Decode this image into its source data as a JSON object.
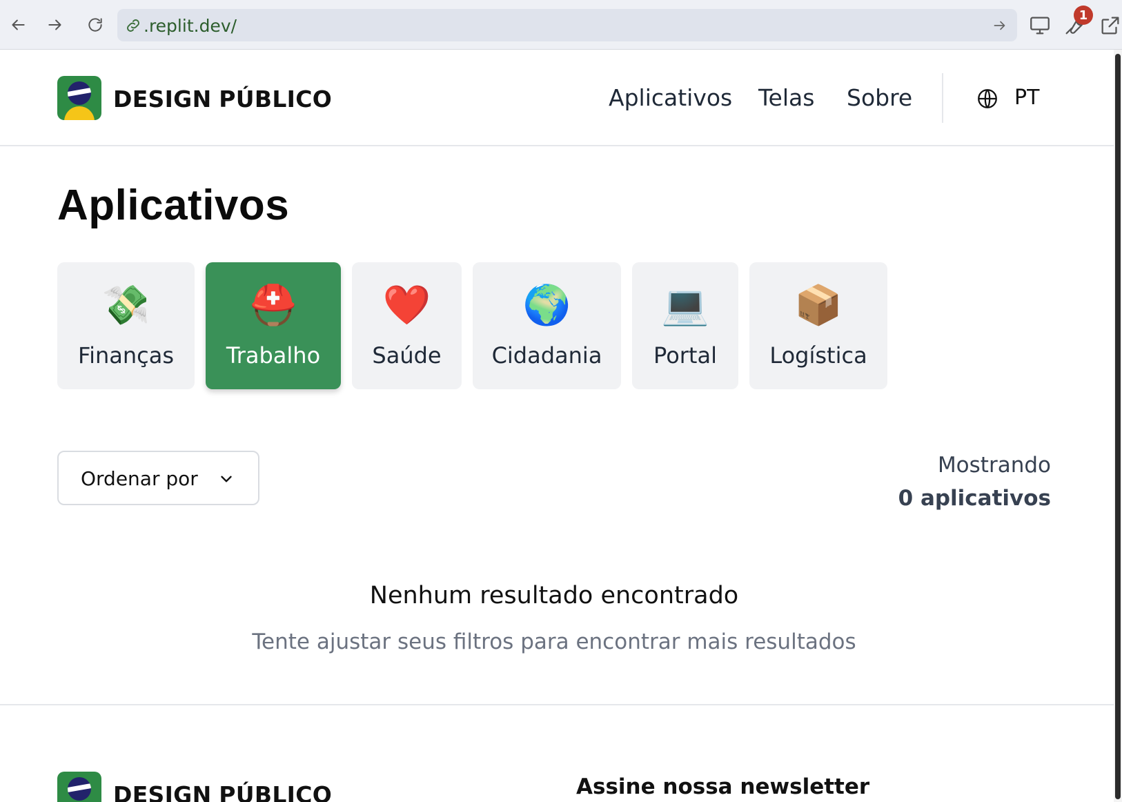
{
  "browser": {
    "url": ".replit.dev/",
    "badge_count": "1",
    "icons": [
      "back-arrow-icon",
      "forward-arrow-icon",
      "reload-icon",
      "link-icon",
      "go-arrow-icon",
      "monitor-icon",
      "wrench-icon",
      "external-link-icon"
    ]
  },
  "header": {
    "brand_bold": "DESIGN",
    "brand_rest": "PÚBLICO",
    "nav": [
      {
        "label": "Aplicativos"
      },
      {
        "label": "Telas"
      },
      {
        "label": "Sobre"
      }
    ],
    "language": "PT"
  },
  "main": {
    "title": "Aplicativos",
    "categories": [
      {
        "emoji": "💸",
        "label": "Finanças",
        "active": false
      },
      {
        "emoji": "⛑️",
        "label": "Trabalho",
        "active": true
      },
      {
        "emoji": "❤️",
        "label": "Saúde",
        "active": false
      },
      {
        "emoji": "🌍",
        "label": "Cidadania",
        "active": false
      },
      {
        "emoji": "💻",
        "label": "Portal",
        "active": false
      },
      {
        "emoji": "📦",
        "label": "Logística",
        "active": false
      }
    ],
    "sort_label": "Ordenar por",
    "results_line1": "Mostrando",
    "results_line2": "0 aplicativos",
    "empty_title": "Nenhum resultado encontrado",
    "empty_subtitle": "Tente ajustar seus filtros para encontrar mais resultados"
  },
  "footer": {
    "brand_bold": "DESIGN",
    "brand_rest": "PÚBLICO",
    "newsletter_title": "Assine nossa newsletter"
  },
  "colors": {
    "accent_green": "#3a9158",
    "logo_green": "#2e8b45",
    "logo_yellow": "#f5c518",
    "logo_blue": "#22236b",
    "badge_red": "#c0392b"
  }
}
